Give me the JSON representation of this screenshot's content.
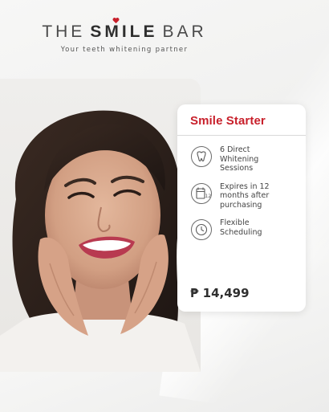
{
  "brand": {
    "logo_part1": "THE",
    "logo_part2": "SMILE",
    "logo_part3": "BAR",
    "tagline": "Your teeth whitening partner",
    "accent_color": "#c8202b"
  },
  "card": {
    "title": "Smile Starter",
    "features": [
      {
        "icon": "tooth-icon",
        "text": "6 Direct Whitening Sessions"
      },
      {
        "icon": "calendar-expiry-icon",
        "text": "Expires in 12 months after purchasing"
      },
      {
        "icon": "clock-icon",
        "text": "Flexible Scheduling"
      }
    ],
    "price": "₱ 14,499"
  },
  "photo": {
    "subject": "smiling-woman-photo"
  }
}
